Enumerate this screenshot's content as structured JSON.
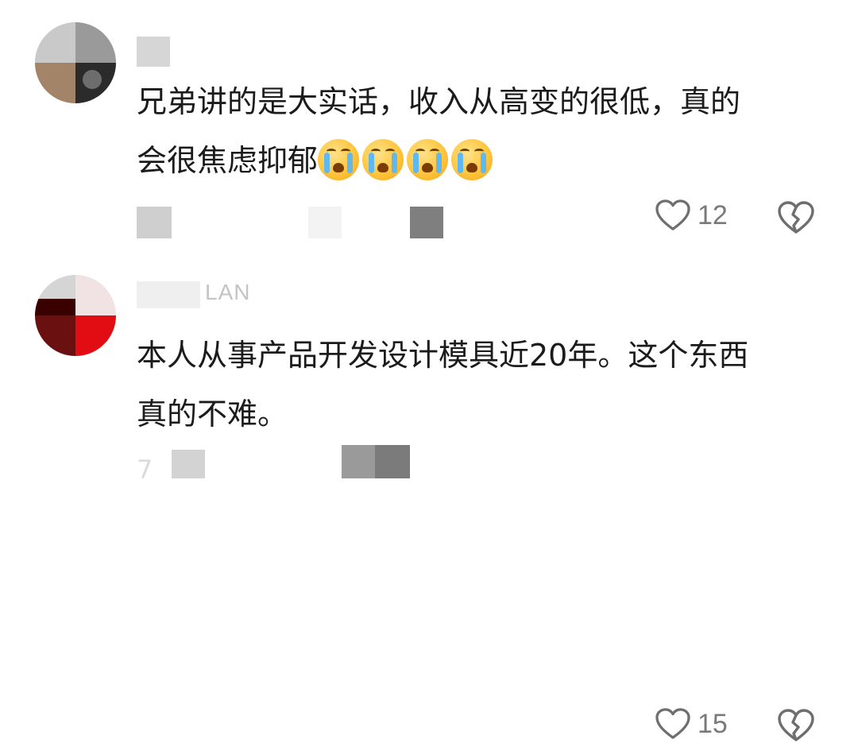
{
  "comments": [
    {
      "username": "",
      "body_lines": [
        "兄弟讲的是大实话，收入从高变的很低，真的",
        "会很焦虑抑郁"
      ],
      "emoji": [
        "crying-face",
        "crying-face",
        "crying-face",
        "crying-face"
      ],
      "likes": "12",
      "meta": ""
    },
    {
      "username": "LAN",
      "body_lines": [
        "本人从事产品开发设计模具近20年。这个东西",
        "真的不难。"
      ],
      "emoji": [],
      "likes": "15",
      "meta": "7"
    }
  ],
  "colors": {
    "text": "#1b1b1b",
    "muted": "#7a7a7a",
    "icon_stroke": "#6e6e6e"
  },
  "icons": {
    "like": "heart-outline-icon",
    "dislike": "broken-heart-icon"
  }
}
